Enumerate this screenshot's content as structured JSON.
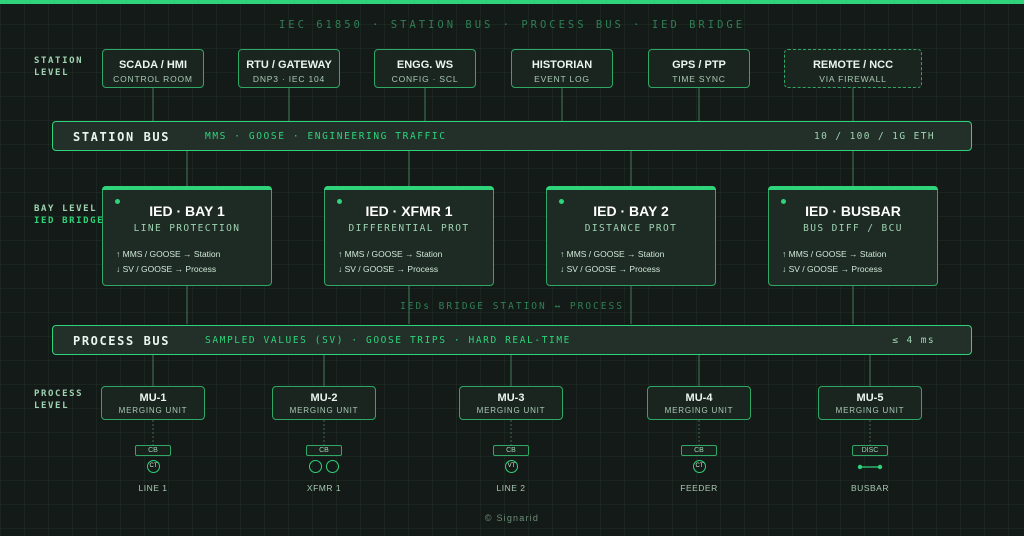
{
  "header": {
    "subtitle": "IEC 61850 · STATION BUS · PROCESS BUS · IED BRIDGE"
  },
  "levels": {
    "station": [
      "STATION",
      "LEVEL"
    ],
    "bay": [
      "BAY LEVEL",
      "IED BRIDGE"
    ],
    "process": [
      "PROCESS",
      "LEVEL"
    ]
  },
  "station_nodes": [
    {
      "title": "SCADA / HMI",
      "sub": "CONTROL ROOM"
    },
    {
      "title": "RTU / GATEWAY",
      "sub": "DNP3 · IEC 104"
    },
    {
      "title": "ENGG. WS",
      "sub": "CONFIG · SCL"
    },
    {
      "title": "HISTORIAN",
      "sub": "EVENT LOG"
    },
    {
      "title": "GPS / PTP",
      "sub": "TIME SYNC"
    },
    {
      "title": "REMOTE / NCC",
      "sub": "VIA FIREWALL"
    }
  ],
  "station_bus": {
    "name": "STATION BUS",
    "desc": "MMS · GOOSE · ENGINEERING TRAFFIC",
    "speed": "10 / 100 / 1G ETH"
  },
  "ieds": [
    {
      "title": "IED · BAY 1",
      "sub": "LINE PROTECTION",
      "up": "↑ MMS / GOOSE → Station",
      "down": "↓ SV / GOOSE → Process"
    },
    {
      "title": "IED · XFMR 1",
      "sub": "DIFFERENTIAL PROT",
      "up": "↑ MMS / GOOSE → Station",
      "down": "↓ SV / GOOSE → Process"
    },
    {
      "title": "IED · BAY 2",
      "sub": "DISTANCE PROT",
      "up": "↑ MMS / GOOSE → Station",
      "down": "↓ SV / GOOSE → Process"
    },
    {
      "title": "IED · BUSBAR",
      "sub": "BUS DIFF / BCU",
      "up": "↑ MMS / GOOSE → Station",
      "down": "↓ SV / GOOSE → Process"
    }
  ],
  "bridge_note": "IEDs BRIDGE STATION ↔ PROCESS",
  "process_bus": {
    "name": "PROCESS BUS",
    "desc": "SAMPLED VALUES (SV) · GOOSE TRIPS · HARD REAL-TIME",
    "latency": "≤ 4 ms"
  },
  "merging_units": [
    {
      "title": "MU-1",
      "sub": "MERGING UNIT",
      "tag": "CB",
      "sensors": [
        "CT"
      ],
      "label": "LINE 1"
    },
    {
      "title": "MU-2",
      "sub": "MERGING UNIT",
      "tag": "CB",
      "sensors": [
        "",
        ""
      ],
      "label": "XFMR 1"
    },
    {
      "title": "MU-3",
      "sub": "MERGING UNIT",
      "tag": "CB",
      "sensors": [
        "VT"
      ],
      "label": "LINE 2"
    },
    {
      "title": "MU-4",
      "sub": "MERGING UNIT",
      "tag": "CB",
      "sensors": [
        "CT"
      ],
      "label": "FEEDER"
    },
    {
      "title": "MU-5",
      "sub": "MERGING UNIT",
      "tag": "DISC",
      "sensors": [],
      "label": "BUSBAR"
    }
  ],
  "footer": "© Signarid",
  "colors": {
    "accent": "#2fd37a",
    "border": "#2fa865",
    "background": "#141a17"
  }
}
